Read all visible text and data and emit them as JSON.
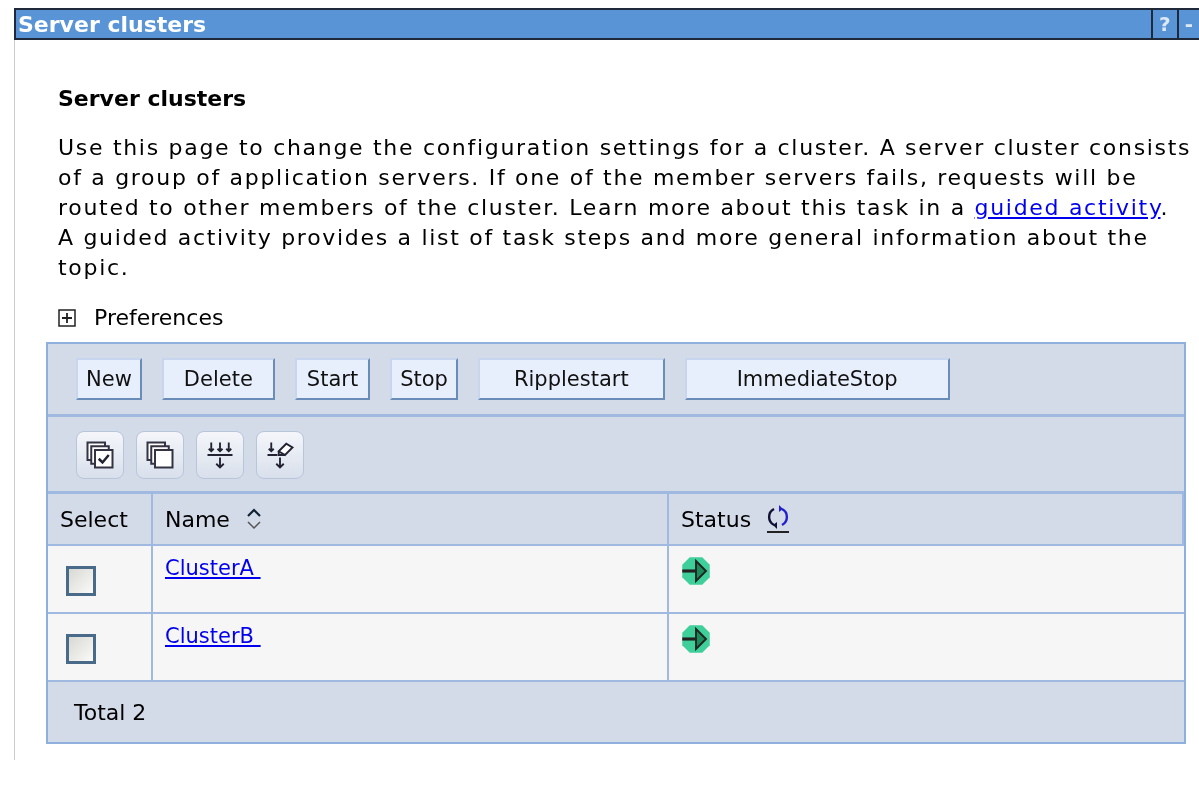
{
  "window": {
    "title": "Server clusters",
    "help": "?",
    "minimize": "-"
  },
  "heading": "Server clusters",
  "description": {
    "before": "Use this page to change the configuration settings for a cluster. A server cluster consists of a group of application servers. If one of the member servers fails, requests will be routed to other members of the cluster. Learn more about this task in a",
    "link": "guided activity",
    "after": ". A guided activity provides a list of task steps and more general information about the topic."
  },
  "preferences": {
    "label": "Preferences",
    "expanded": false
  },
  "buttons": [
    {
      "label": "New"
    },
    {
      "label": "Delete"
    },
    {
      "label": "Start"
    },
    {
      "label": "Stop"
    },
    {
      "label": "Ripplestart"
    },
    {
      "label": "ImmediateStop"
    }
  ],
  "tools": [
    {
      "kind": "select-all"
    },
    {
      "kind": "deselect-all"
    },
    {
      "kind": "filter"
    },
    {
      "kind": "clear-filter"
    }
  ],
  "table": {
    "columns": [
      {
        "label": "Select",
        "kind": "plain"
      },
      {
        "label": "Name",
        "kind": "sort"
      },
      {
        "label": "Status",
        "kind": "refresh"
      }
    ],
    "rows": [
      {
        "name": "ClusterA ",
        "checked": false,
        "running": true
      },
      {
        "name": "ClusterB ",
        "checked": false,
        "running": true
      }
    ],
    "total": "Total 2"
  }
}
